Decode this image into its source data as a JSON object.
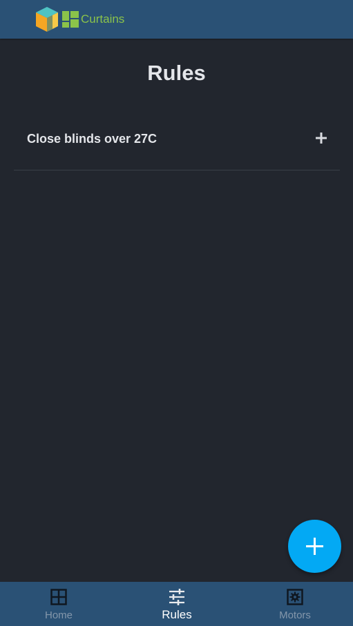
{
  "header": {
    "brand_name": "Curtains"
  },
  "page": {
    "title": "Rules"
  },
  "rules": [
    {
      "label": "Close blinds over 27C"
    }
  ],
  "fab": {
    "icon": "plus-icon"
  },
  "nav": {
    "items": [
      {
        "label": "Home",
        "icon": "grid-icon",
        "active": false
      },
      {
        "label": "Rules",
        "icon": "sliders-icon",
        "active": true
      },
      {
        "label": "Motors",
        "icon": "gear-box-icon",
        "active": false
      }
    ]
  },
  "colors": {
    "background": "#22262e",
    "bar": "#2a5175",
    "brand": "#8bc34a",
    "accent": "#03a9f4",
    "text": "#e4e6ea",
    "nav_inactive": "#8497ab"
  }
}
